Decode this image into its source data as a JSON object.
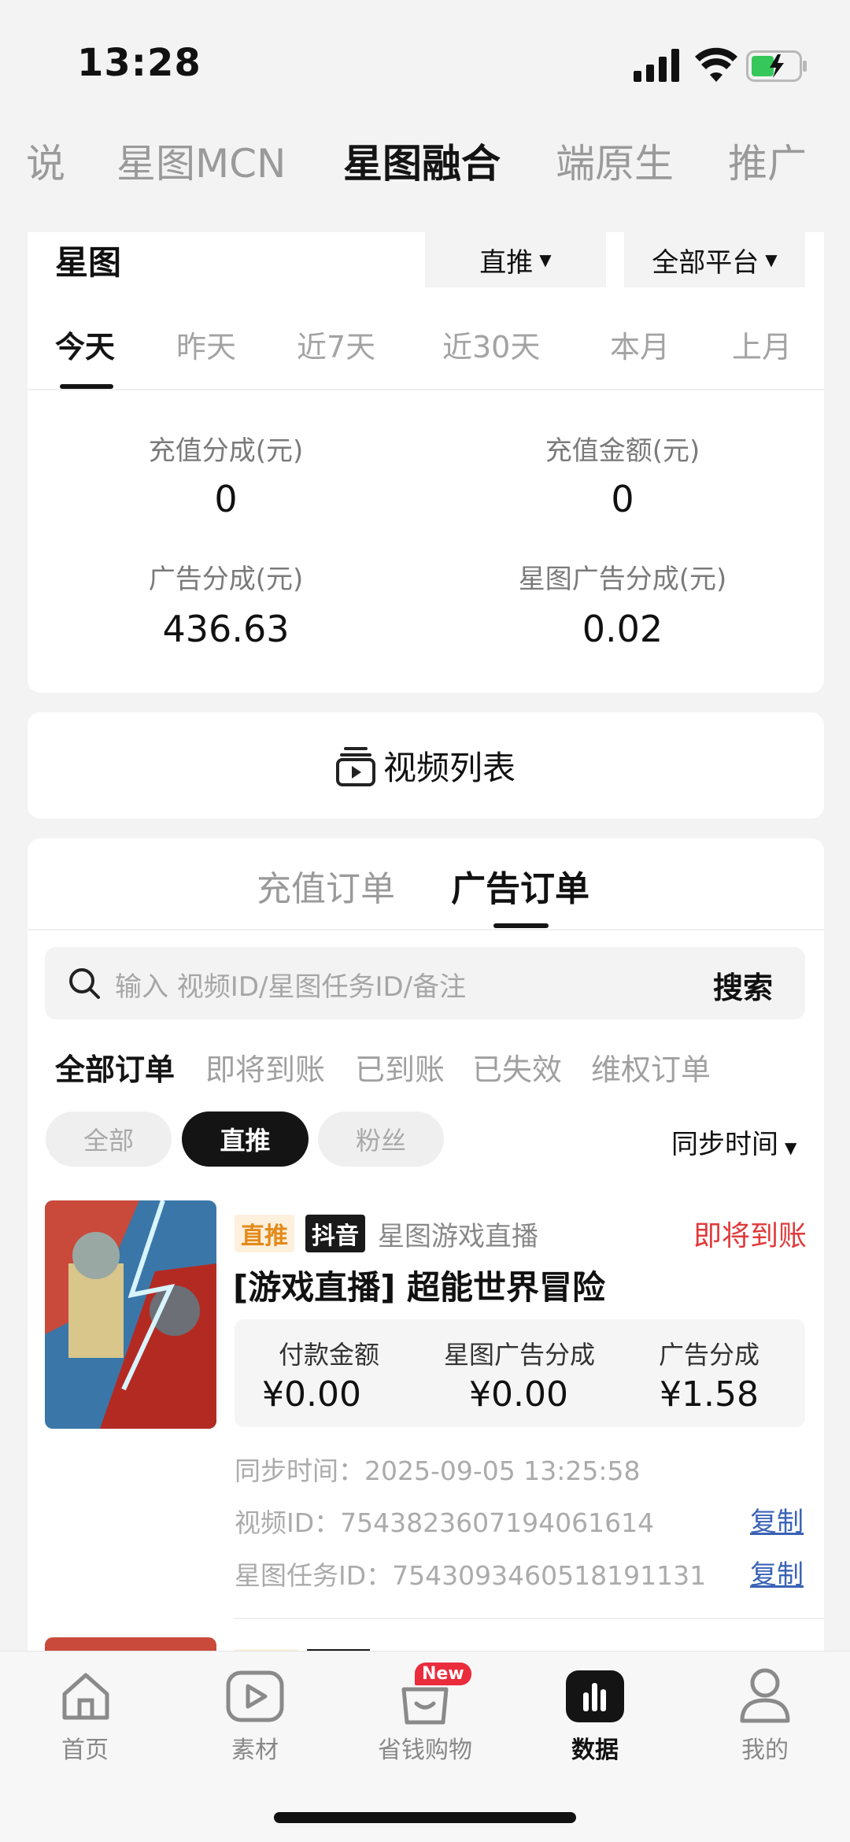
{
  "status": {
    "time": "13:28"
  },
  "top_tabs": [
    {
      "label": "说"
    },
    {
      "label": "星图MCN"
    },
    {
      "label": "星图融合"
    },
    {
      "label": "端原生"
    },
    {
      "label": "推广"
    }
  ],
  "summary": {
    "title": "星图",
    "filter_type": "直推",
    "filter_platform": "全部平台",
    "date_tabs": [
      "今天",
      "昨天",
      "近7天",
      "近30天",
      "本月",
      "上月"
    ],
    "stats": [
      {
        "label": "充值分成(元)",
        "value": "0"
      },
      {
        "label": "充值金额(元)",
        "value": "0"
      },
      {
        "label": "广告分成(元)",
        "value": "436.63"
      },
      {
        "label": "星图广告分成(元)",
        "value": "0.02"
      }
    ]
  },
  "video_list": {
    "label": "视频列表"
  },
  "orders": {
    "tabs": [
      "充值订单",
      "广告订单"
    ],
    "search_placeholder": "输入 视频ID/星图任务ID/备注",
    "search_button": "搜索",
    "status_filters": [
      "全部订单",
      "即将到账",
      "已到账",
      "已失效",
      "维权订单"
    ],
    "pills": [
      "全部",
      "直推",
      "粉丝"
    ],
    "sort_label": "同步时间",
    "items": [
      {
        "badge_type": "直推",
        "badge_platform": "抖音",
        "source": "星图游戏直播",
        "status": "即将到账",
        "title": "[游戏直播] 超能世界冒险",
        "amounts": [
          {
            "label": "付款金额",
            "value": "¥0.00"
          },
          {
            "label": "星图广告分成",
            "value": "¥0.00"
          },
          {
            "label": "广告分成",
            "value": "¥1.58"
          }
        ],
        "sync_time": "同步时间：2025-09-05 13:25:58",
        "video_id": "视频ID：7543823607194061614",
        "task_id": "星图任务ID：7543093460518191131",
        "copy_label": "复制"
      }
    ]
  },
  "bottom_nav": [
    {
      "label": "首页"
    },
    {
      "label": "素材"
    },
    {
      "label": "省钱购物",
      "badge": "New"
    },
    {
      "label": "数据"
    },
    {
      "label": "我的"
    }
  ]
}
